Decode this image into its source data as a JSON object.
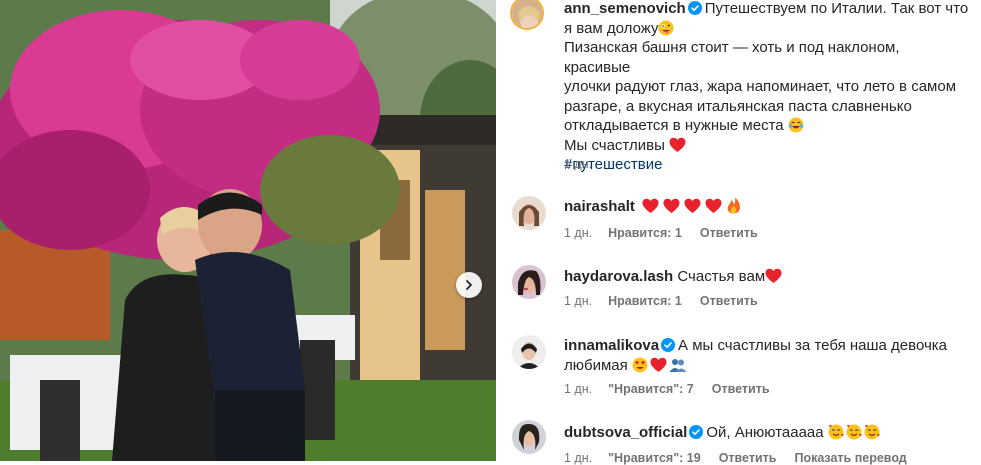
{
  "post": {
    "username": "ann_semenovich",
    "caption_head": "Путешествуем по Италии. Так вот что я вам доложу",
    "caption_lines": [
      "Пизанская башня стоит — хоть и под наклоном, красивые",
      "улочки радуют глаз, жара напоминает, что лето в самом",
      "разгаре, а вкусная итальянская паста славненько",
      "откладывается в нужные места"
    ],
    "caption_end": "Мы счастливы",
    "hashtag": "#путешествие",
    "time": "1 дн."
  },
  "comments": [
    {
      "username": "nairashalt",
      "text": "",
      "time": "1 дн.",
      "likes": "Нравится: 1",
      "reply": "Ответить"
    },
    {
      "username": "haydarova.lash",
      "text": "Счастья вам",
      "time": "1 дн.",
      "likes": "Нравится: 1",
      "reply": "Ответить"
    },
    {
      "username": "innamalikova",
      "text_line1": "А мы счастливы за тебя наша девочка",
      "text_line2": "любимая",
      "time": "1 дн.",
      "likes": "\"Нравится\": 7",
      "reply": "Ответить"
    },
    {
      "username": "dubtsova_official",
      "text": "Ой, Анюютааааа",
      "time": "1 дн.",
      "likes": "\"Нравится\": 19",
      "reply": "Ответить",
      "translate": "Показать перевод"
    }
  ],
  "icons": {
    "verified": "verified-badge-icon",
    "next": "chevron-right-icon",
    "heart": "red-heart-emoji",
    "fire": "fire-emoji",
    "laugh": "tears-of-joy-emoji",
    "wink": "zany-face-emoji",
    "heart_eyes": "heart-eyes-emoji",
    "people": "people-silhouette-emoji",
    "hearts_face": "smiling-face-with-hearts-emoji"
  },
  "colors": {
    "verified": "#0095f6",
    "heart": "#e8222d",
    "hashtag": "#00376b",
    "meta": "#737373"
  }
}
